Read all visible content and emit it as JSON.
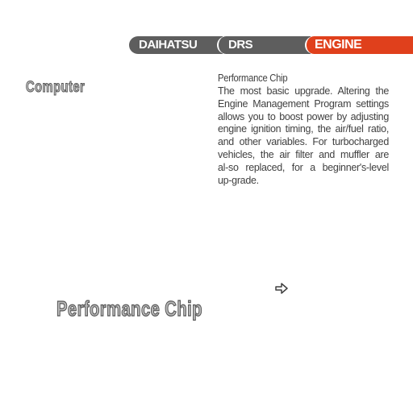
{
  "tabs": {
    "daihatsu": "DAIHATSU",
    "drs": "DRS",
    "engine": "ENGINE",
    "active": "ENGINE"
  },
  "category": "Computer",
  "description": {
    "title": "Performance Chip",
    "body": "The most basic upgrade. Altering the Engine Management Program settings allows you to boost power by adjusting engine ignition timing, the air/fuel ratio, and other variables. For turbocharged vehicles, the air filter and muffler are al-so replaced, for a beginner's-level up-grade."
  },
  "part_name": "Performance Chip",
  "icons": {
    "next": "arrow-right-icon"
  },
  "colors": {
    "tab_inactive": "#5e5e5e",
    "tab_active": "#e0401c"
  }
}
